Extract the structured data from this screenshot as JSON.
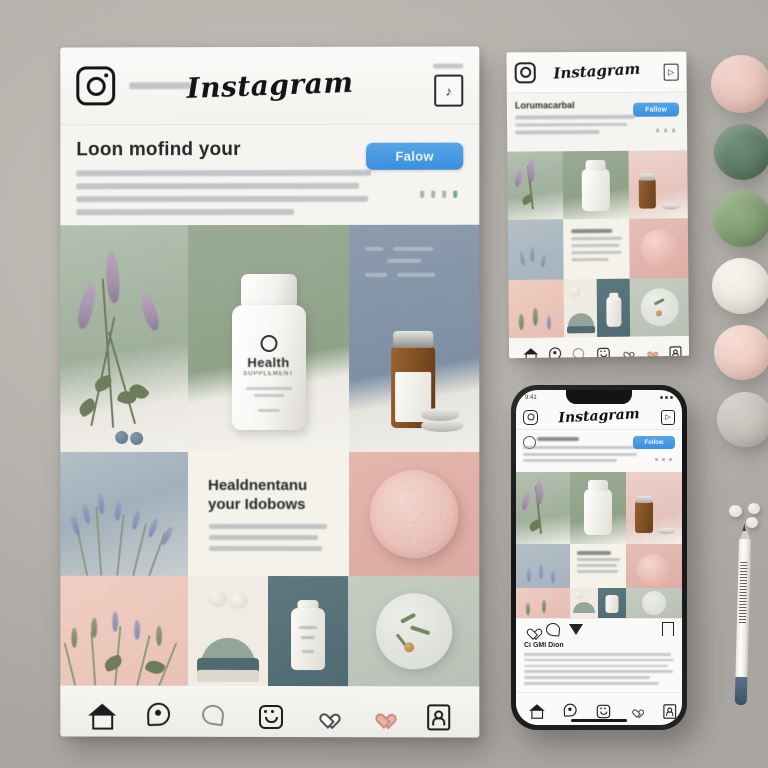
{
  "scene": {
    "background_color": "#b9b6b0",
    "accent_blue": "#3b8fdd"
  },
  "main_card": {
    "topbar": {
      "camera_icon": "instagram-camera-icon",
      "handle_placeholder": "",
      "wordmark": "Instagram",
      "messages_icon": "direct-message-icon",
      "messages_glyph": "♪"
    },
    "profile": {
      "heading": "Loon mofind your",
      "bio_lines": [
        "",
        "",
        "",
        ""
      ],
      "follow_label": "Falow",
      "stats": [
        "",
        "",
        "",
        ""
      ]
    },
    "grid": {
      "row1": [
        {
          "name": "herb-sprig-photo",
          "caption": ""
        },
        {
          "name": "white-supplement-bottle-photo",
          "label_title": "Health",
          "label_sub": "SUPPLEMENT"
        },
        {
          "name": "amber-vial-photo",
          "caption": ""
        }
      ],
      "row2": [
        {
          "name": "lavender-field-photo",
          "caption": ""
        },
        {
          "name": "text-quote-card",
          "heading": "Healdnentanu\nyour Idobows",
          "lines": [
            "",
            "",
            ""
          ]
        },
        {
          "name": "pink-round-tablet-photo",
          "caption": ""
        }
      ],
      "row3": [
        {
          "name": "pink-lavender-photo",
          "caption": ""
        },
        {
          "name": "abstract-shapes-card",
          "caption": ""
        },
        {
          "name": "teal-bottle-photo",
          "caption": ""
        },
        {
          "name": "herb-plate-photo",
          "caption": ""
        }
      ]
    },
    "nav": [
      {
        "icon": "home-icon",
        "label": "Home"
      },
      {
        "icon": "search-icon",
        "label": "Search"
      },
      {
        "icon": "comment-icon",
        "label": "Comments"
      },
      {
        "icon": "reels-icon",
        "label": "Reels"
      },
      {
        "icon": "heart-icon",
        "label": "Likes"
      },
      {
        "icon": "heart-filled-icon",
        "label": "Liked"
      },
      {
        "icon": "profile-icon",
        "label": "Profile"
      }
    ]
  },
  "second_card": {
    "topbar": {
      "camera_icon": "instagram-camera-icon",
      "wordmark": "Instagram",
      "messages_glyph": "▷"
    },
    "profile": {
      "heading": "Lorumacarbal",
      "bio_lines": [
        "",
        "",
        ""
      ],
      "follow_label": "Fallow"
    },
    "nav": [
      {
        "icon": "home-icon"
      },
      {
        "icon": "search-icon"
      },
      {
        "icon": "comment-icon"
      },
      {
        "icon": "reels-icon"
      },
      {
        "icon": "heart-icon"
      },
      {
        "icon": "heart-filled-icon"
      },
      {
        "icon": "profile-icon"
      }
    ]
  },
  "phone": {
    "status_bar": {
      "time": "9:41",
      "indicators": ""
    },
    "topbar": {
      "camera_icon": "instagram-camera-icon",
      "wordmark": "Instagram",
      "messages_glyph": "▷"
    },
    "profile": {
      "name": "",
      "bio_lines": [
        "",
        "",
        ""
      ],
      "follow_label": "Follow"
    },
    "post_actions": [
      {
        "icon": "heart-icon",
        "label": "Like"
      },
      {
        "icon": "comment-icon",
        "label": "Comment"
      },
      {
        "icon": "share-icon",
        "label": "Share"
      },
      {
        "icon": "bookmark-icon",
        "label": "Save"
      }
    ],
    "caption": {
      "title": "Ci GMI Dion",
      "lines": [
        "",
        "",
        "",
        "",
        "",
        ""
      ]
    },
    "nav": [
      {
        "icon": "home-icon"
      },
      {
        "icon": "search-icon"
      },
      {
        "icon": "reels-icon"
      },
      {
        "icon": "heart-icon"
      },
      {
        "icon": "profile-icon"
      }
    ]
  },
  "swatches": [
    {
      "name": "swatch-blush-pink",
      "color": "#e7c5bd",
      "text": ""
    },
    {
      "name": "swatch-deep-green",
      "color": "#5d7a63",
      "text": ""
    },
    {
      "name": "swatch-sage-green",
      "color": "#7f9c70",
      "text": ""
    },
    {
      "name": "swatch-cream",
      "color": "#e9e7dc",
      "text": ""
    },
    {
      "name": "swatch-rose",
      "color": "#edc9c0",
      "text": ""
    },
    {
      "name": "swatch-warm-gray",
      "color": "#c5c2bb",
      "text": ""
    }
  ],
  "desk_props": {
    "pencil": {
      "name": "white-pencil",
      "tip_color": "#3b4654",
      "body_color": "#f6f4ee"
    },
    "beads": [
      {
        "name": "bead-1"
      },
      {
        "name": "bead-2"
      },
      {
        "name": "bead-3"
      }
    ]
  }
}
